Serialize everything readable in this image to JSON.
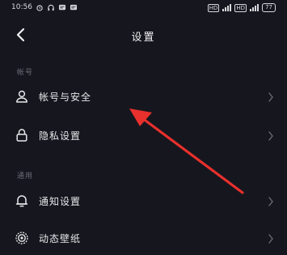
{
  "status_bar": {
    "time": "10:56",
    "network_1": "HD",
    "network_2": "HD",
    "battery": "77"
  },
  "header": {
    "title": "设置"
  },
  "sections": [
    {
      "label": "帐号",
      "items": [
        {
          "label": "帐号与安全",
          "icon": "person-icon"
        },
        {
          "label": "隐私设置",
          "icon": "lock-icon"
        }
      ]
    },
    {
      "label": "通用",
      "items": [
        {
          "label": "通知设置",
          "icon": "bell-icon"
        },
        {
          "label": "动态壁纸",
          "icon": "wallpaper-icon"
        }
      ]
    }
  ],
  "colors": {
    "background": "#16161e",
    "annotation_arrow": "#e8302c"
  }
}
